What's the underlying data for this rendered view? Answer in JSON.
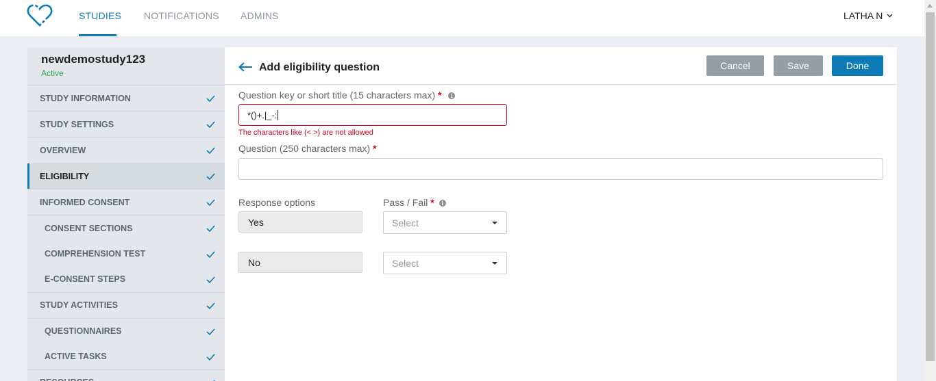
{
  "nav": {
    "tabs": [
      "STUDIES",
      "NOTIFICATIONS",
      "ADMINS"
    ],
    "user": "LATHA N"
  },
  "sidebar": {
    "study_name": "newdemostudy123",
    "study_status": "Active",
    "items": [
      {
        "label": "STUDY INFORMATION"
      },
      {
        "label": "STUDY SETTINGS"
      },
      {
        "label": "OVERVIEW"
      },
      {
        "label": "ELIGIBILITY"
      },
      {
        "label": "INFORMED CONSENT"
      },
      {
        "label": "CONSENT SECTIONS"
      },
      {
        "label": "COMPREHENSION TEST"
      },
      {
        "label": "E-CONSENT STEPS"
      },
      {
        "label": "STUDY ACTIVITIES"
      },
      {
        "label": "QUESTIONNAIRES"
      },
      {
        "label": "ACTIVE TASKS"
      },
      {
        "label": "RESOURCES"
      }
    ]
  },
  "header": {
    "title": "Add eligibility question",
    "cancel": "Cancel",
    "save": "Save",
    "done": "Done"
  },
  "form": {
    "key_label": "Question key or short title (15 characters max)",
    "key_value": "*()+.|_-:",
    "key_error": "The characters like (< >) are not allowed",
    "question_label": "Question (250 characters max)",
    "question_value": "",
    "response_label": "Response options",
    "passfail_label": "Pass / Fail",
    "required_mark": "*",
    "info_glyph": "i",
    "options": [
      {
        "response": "Yes",
        "select_placeholder": "Select"
      },
      {
        "response": "No",
        "select_placeholder": "Select"
      }
    ]
  },
  "colors": {
    "brand": "#0c7ab5",
    "error": "#d0021b",
    "status_active": "#2ca84a"
  }
}
